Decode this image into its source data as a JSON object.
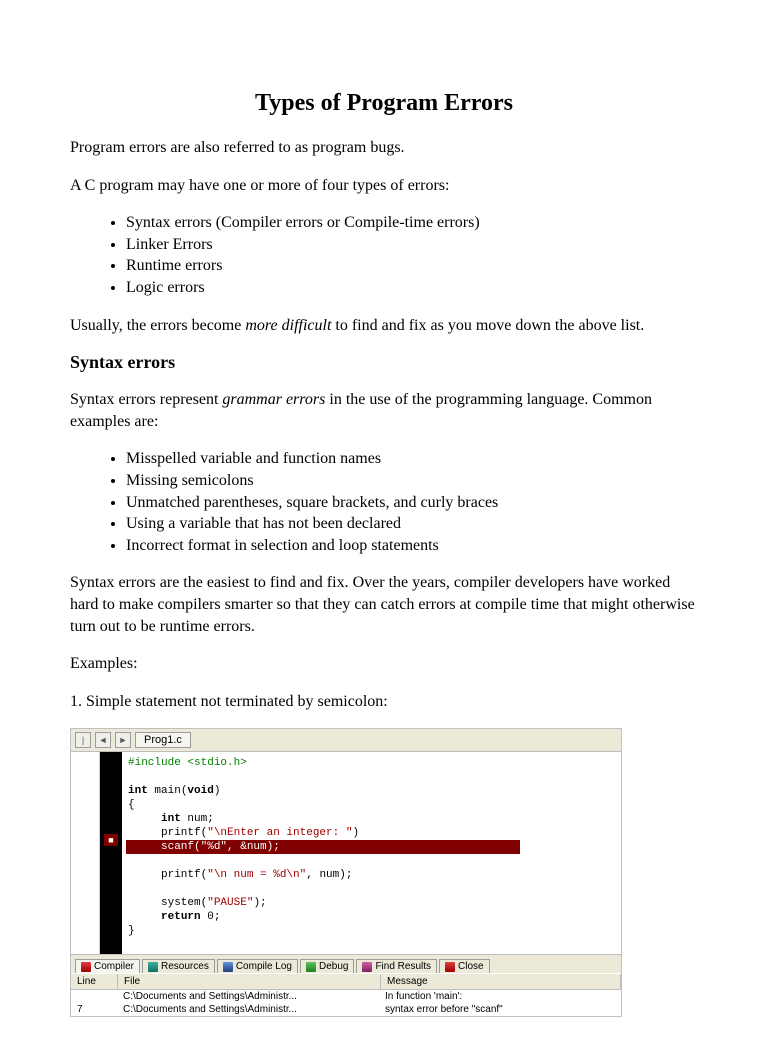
{
  "title": "Types of Program Errors",
  "intro1": "Program errors are also referred to as program bugs.",
  "intro2": "A C program may have one or more of four types of errors:",
  "errorTypes": [
    "Syntax errors (Compiler errors or Compile-time errors)",
    "Linker Errors",
    "Runtime errors",
    "Logic errors"
  ],
  "usually_pre": "Usually, the errors become ",
  "usually_em": "more difficult",
  "usually_post": " to find and fix as you move down the above list.",
  "h2_syntax": "Syntax errors",
  "syntax_p1_pre": "Syntax errors represent ",
  "syntax_p1_em": "grammar errors",
  "syntax_p1_post": " in the use of the programming language.  Common examples are:",
  "syntaxExamples": [
    "Misspelled variable and function names",
    "Missing semicolons",
    "Unmatched parentheses, square brackets, and curly braces",
    "Using a variable that has not been declared",
    "Incorrect format in selection and loop statements"
  ],
  "syntax_p2": "Syntax errors are the easiest to find and fix. Over the years, compiler developers have worked hard to make compilers smarter so that they can catch errors at compile time that might otherwise turn out to be runtime errors.",
  "examples_label": "Examples:",
  "ex1": "1. Simple statement not terminated by semicolon:",
  "ide": {
    "nav_prev": "◄",
    "nav_next": "►",
    "filetab": "Prog1.c",
    "bp": "■",
    "code": {
      "l1a": "#include ",
      "l1b": "<stdio.h>",
      "l2a": "int",
      "l2b": " main(",
      "l2c": "void",
      "l2d": ")",
      "l3": "{",
      "l4a": "int",
      "l4b": " num;",
      "l5a": "     printf(",
      "l5b": "\"\\nEnter an integer: \"",
      "l5c": ")",
      "l6a": "     scanf(",
      "l6b": "\"%d\"",
      "l6c": ", &num);",
      "l7a": "     printf(",
      "l7b": "\"\\n num = %d\\n\"",
      "l7c": ", num);",
      "l8a": "     system(",
      "l8b": "\"PAUSE\"",
      "l8c": ");",
      "l9a": "return",
      "l9b": " 0;",
      "l10": "}"
    },
    "btabs": [
      "Compiler",
      "Resources",
      "Compile Log",
      "Debug",
      "Find Results",
      "Close"
    ],
    "headers": {
      "line": "Line",
      "file": "File",
      "msg": "Message"
    },
    "rows": [
      {
        "line": "",
        "file": "C:\\Documents and Settings\\Administr...",
        "msg": "In function 'main':"
      },
      {
        "line": "7",
        "file": "C:\\Documents and Settings\\Administr...",
        "msg": "syntax error before \"scanf\""
      }
    ]
  }
}
